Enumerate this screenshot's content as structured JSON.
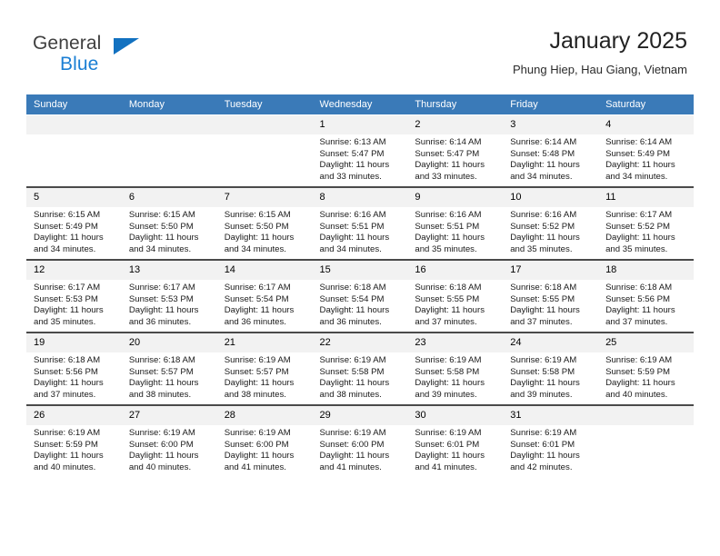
{
  "brand": {
    "word_one": "General",
    "word_two": "Blue",
    "triangle_color": "#1271c0",
    "blue_color": "#1b7fd4"
  },
  "header": {
    "title": "January 2025",
    "subtitle": "Phung Hiep, Hau Giang, Vietnam"
  },
  "calendar": {
    "header_bg": "#3a7ab8",
    "daynum_bg": "#f2f2f2",
    "weekday_headers": [
      "Sunday",
      "Monday",
      "Tuesday",
      "Wednesday",
      "Thursday",
      "Friday",
      "Saturday"
    ],
    "weeks": [
      [
        {
          "day": "",
          "lines": []
        },
        {
          "day": "",
          "lines": []
        },
        {
          "day": "",
          "lines": []
        },
        {
          "day": "1",
          "lines": [
            "Sunrise: 6:13 AM",
            "Sunset: 5:47 PM",
            "Daylight: 11 hours",
            "and 33 minutes."
          ]
        },
        {
          "day": "2",
          "lines": [
            "Sunrise: 6:14 AM",
            "Sunset: 5:47 PM",
            "Daylight: 11 hours",
            "and 33 minutes."
          ]
        },
        {
          "day": "3",
          "lines": [
            "Sunrise: 6:14 AM",
            "Sunset: 5:48 PM",
            "Daylight: 11 hours",
            "and 34 minutes."
          ]
        },
        {
          "day": "4",
          "lines": [
            "Sunrise: 6:14 AM",
            "Sunset: 5:49 PM",
            "Daylight: 11 hours",
            "and 34 minutes."
          ]
        }
      ],
      [
        {
          "day": "5",
          "lines": [
            "Sunrise: 6:15 AM",
            "Sunset: 5:49 PM",
            "Daylight: 11 hours",
            "and 34 minutes."
          ]
        },
        {
          "day": "6",
          "lines": [
            "Sunrise: 6:15 AM",
            "Sunset: 5:50 PM",
            "Daylight: 11 hours",
            "and 34 minutes."
          ]
        },
        {
          "day": "7",
          "lines": [
            "Sunrise: 6:15 AM",
            "Sunset: 5:50 PM",
            "Daylight: 11 hours",
            "and 34 minutes."
          ]
        },
        {
          "day": "8",
          "lines": [
            "Sunrise: 6:16 AM",
            "Sunset: 5:51 PM",
            "Daylight: 11 hours",
            "and 34 minutes."
          ]
        },
        {
          "day": "9",
          "lines": [
            "Sunrise: 6:16 AM",
            "Sunset: 5:51 PM",
            "Daylight: 11 hours",
            "and 35 minutes."
          ]
        },
        {
          "day": "10",
          "lines": [
            "Sunrise: 6:16 AM",
            "Sunset: 5:52 PM",
            "Daylight: 11 hours",
            "and 35 minutes."
          ]
        },
        {
          "day": "11",
          "lines": [
            "Sunrise: 6:17 AM",
            "Sunset: 5:52 PM",
            "Daylight: 11 hours",
            "and 35 minutes."
          ]
        }
      ],
      [
        {
          "day": "12",
          "lines": [
            "Sunrise: 6:17 AM",
            "Sunset: 5:53 PM",
            "Daylight: 11 hours",
            "and 35 minutes."
          ]
        },
        {
          "day": "13",
          "lines": [
            "Sunrise: 6:17 AM",
            "Sunset: 5:53 PM",
            "Daylight: 11 hours",
            "and 36 minutes."
          ]
        },
        {
          "day": "14",
          "lines": [
            "Sunrise: 6:17 AM",
            "Sunset: 5:54 PM",
            "Daylight: 11 hours",
            "and 36 minutes."
          ]
        },
        {
          "day": "15",
          "lines": [
            "Sunrise: 6:18 AM",
            "Sunset: 5:54 PM",
            "Daylight: 11 hours",
            "and 36 minutes."
          ]
        },
        {
          "day": "16",
          "lines": [
            "Sunrise: 6:18 AM",
            "Sunset: 5:55 PM",
            "Daylight: 11 hours",
            "and 37 minutes."
          ]
        },
        {
          "day": "17",
          "lines": [
            "Sunrise: 6:18 AM",
            "Sunset: 5:55 PM",
            "Daylight: 11 hours",
            "and 37 minutes."
          ]
        },
        {
          "day": "18",
          "lines": [
            "Sunrise: 6:18 AM",
            "Sunset: 5:56 PM",
            "Daylight: 11 hours",
            "and 37 minutes."
          ]
        }
      ],
      [
        {
          "day": "19",
          "lines": [
            "Sunrise: 6:18 AM",
            "Sunset: 5:56 PM",
            "Daylight: 11 hours",
            "and 37 minutes."
          ]
        },
        {
          "day": "20",
          "lines": [
            "Sunrise: 6:18 AM",
            "Sunset: 5:57 PM",
            "Daylight: 11 hours",
            "and 38 minutes."
          ]
        },
        {
          "day": "21",
          "lines": [
            "Sunrise: 6:19 AM",
            "Sunset: 5:57 PM",
            "Daylight: 11 hours",
            "and 38 minutes."
          ]
        },
        {
          "day": "22",
          "lines": [
            "Sunrise: 6:19 AM",
            "Sunset: 5:58 PM",
            "Daylight: 11 hours",
            "and 38 minutes."
          ]
        },
        {
          "day": "23",
          "lines": [
            "Sunrise: 6:19 AM",
            "Sunset: 5:58 PM",
            "Daylight: 11 hours",
            "and 39 minutes."
          ]
        },
        {
          "day": "24",
          "lines": [
            "Sunrise: 6:19 AM",
            "Sunset: 5:58 PM",
            "Daylight: 11 hours",
            "and 39 minutes."
          ]
        },
        {
          "day": "25",
          "lines": [
            "Sunrise: 6:19 AM",
            "Sunset: 5:59 PM",
            "Daylight: 11 hours",
            "and 40 minutes."
          ]
        }
      ],
      [
        {
          "day": "26",
          "lines": [
            "Sunrise: 6:19 AM",
            "Sunset: 5:59 PM",
            "Daylight: 11 hours",
            "and 40 minutes."
          ]
        },
        {
          "day": "27",
          "lines": [
            "Sunrise: 6:19 AM",
            "Sunset: 6:00 PM",
            "Daylight: 11 hours",
            "and 40 minutes."
          ]
        },
        {
          "day": "28",
          "lines": [
            "Sunrise: 6:19 AM",
            "Sunset: 6:00 PM",
            "Daylight: 11 hours",
            "and 41 minutes."
          ]
        },
        {
          "day": "29",
          "lines": [
            "Sunrise: 6:19 AM",
            "Sunset: 6:00 PM",
            "Daylight: 11 hours",
            "and 41 minutes."
          ]
        },
        {
          "day": "30",
          "lines": [
            "Sunrise: 6:19 AM",
            "Sunset: 6:01 PM",
            "Daylight: 11 hours",
            "and 41 minutes."
          ]
        },
        {
          "day": "31",
          "lines": [
            "Sunrise: 6:19 AM",
            "Sunset: 6:01 PM",
            "Daylight: 11 hours",
            "and 42 minutes."
          ]
        },
        {
          "day": "",
          "lines": []
        }
      ]
    ]
  }
}
